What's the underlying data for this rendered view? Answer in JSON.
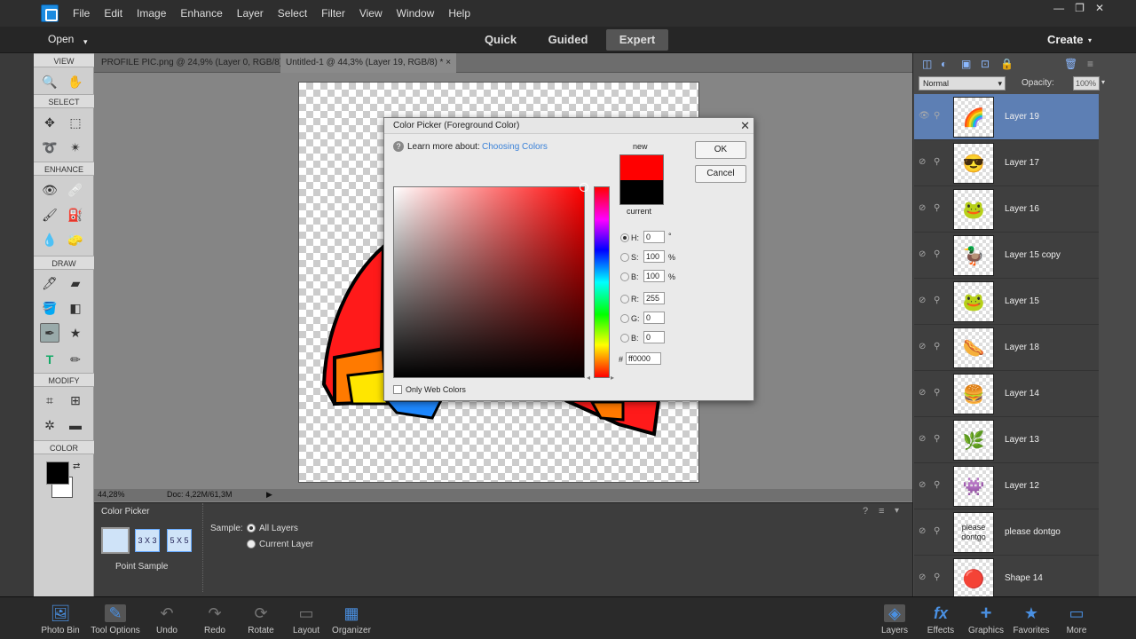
{
  "menubar": {
    "items": [
      "File",
      "Edit",
      "Image",
      "Enhance",
      "Layer",
      "Select",
      "Filter",
      "View",
      "Window",
      "Help"
    ],
    "win_controls": [
      "—",
      "❐",
      "✕"
    ]
  },
  "modebar": {
    "open_label": "Open",
    "tabs": [
      "Quick",
      "Guided",
      "Expert"
    ],
    "active": "Expert",
    "create_label": "Create"
  },
  "toolbar": {
    "sections": [
      "VIEW",
      "SELECT",
      "ENHANCE",
      "DRAW",
      "MODIFY",
      "COLOR"
    ],
    "foreground": "#000000",
    "background": "#ffffff"
  },
  "doc_tabs": [
    {
      "label": "PROFILE PIC.png @ 24,9% (Layer 0, RGB/8)",
      "close": "×"
    },
    {
      "label": "Untitled-1 @ 44,3% (Layer 19, RGB/8) *",
      "close": "×"
    }
  ],
  "statusbar": {
    "zoom": "44,28%",
    "doc": "Doc: 4,22M/61,3M"
  },
  "tool_options": {
    "title": "Color Picker",
    "samples": [
      "",
      "3 X 3",
      "5 X 5"
    ],
    "sample_caption": "Point Sample",
    "sample_label": "Sample:",
    "radio_all": "All Layers",
    "radio_current": "Current Layer"
  },
  "layers_panel": {
    "blend_mode": "Normal",
    "opacity_label": "Opacity:",
    "opacity_value": "100%",
    "layers": [
      {
        "name": "Layer 19",
        "icon": "🌈"
      },
      {
        "name": "Layer 17",
        "icon": "😎"
      },
      {
        "name": "Layer 16",
        "icon": "🐸"
      },
      {
        "name": "Layer 15 copy",
        "icon": "🦆"
      },
      {
        "name": "Layer 15",
        "icon": "🐸"
      },
      {
        "name": "Layer 18",
        "icon": "🌭"
      },
      {
        "name": "Layer 14",
        "icon": "🍔"
      },
      {
        "name": "Layer 13",
        "icon": "🌿"
      },
      {
        "name": "Layer 12",
        "icon": "👾"
      },
      {
        "name": "please dontgo",
        "icon": "please dontgo"
      },
      {
        "name": "Shape 14",
        "icon": "🔴"
      }
    ]
  },
  "bottombar": {
    "left": [
      {
        "label": "Photo Bin",
        "icon": "🖼"
      },
      {
        "label": "Tool Options",
        "icon": "✎"
      },
      {
        "label": "Undo",
        "icon": "↶"
      },
      {
        "label": "Redo",
        "icon": "↷"
      },
      {
        "label": "Rotate",
        "icon": "⟳"
      },
      {
        "label": "Layout",
        "icon": "▭"
      },
      {
        "label": "Organizer",
        "icon": "▦"
      }
    ],
    "right": [
      {
        "label": "Layers",
        "icon": "◈"
      },
      {
        "label": "Effects",
        "icon": "fx"
      },
      {
        "label": "Graphics",
        "icon": "+"
      },
      {
        "label": "Favorites",
        "icon": "★"
      },
      {
        "label": "More",
        "icon": "▭"
      }
    ]
  },
  "dialog": {
    "title": "Color Picker (Foreground Color)",
    "close": "✕",
    "learn": "Learn more about:",
    "learn_link": "Choosing Colors",
    "new_label": "new",
    "current_label": "current",
    "ok": "OK",
    "cancel": "Cancel",
    "new_color": "#ff0000",
    "current_color": "#000000",
    "h_label": "H:",
    "h": "0",
    "h_unit": "°",
    "s_label": "S:",
    "s": "100",
    "s_unit": "%",
    "b_label": "B:",
    "b": "100",
    "b_unit": "%",
    "r_label": "R:",
    "r": "255",
    "g_label": "G:",
    "g": "0",
    "bl_label": "B:",
    "bl": "0",
    "hex_label": "#",
    "hex": "ff0000",
    "only_web": "Only Web Colors"
  }
}
